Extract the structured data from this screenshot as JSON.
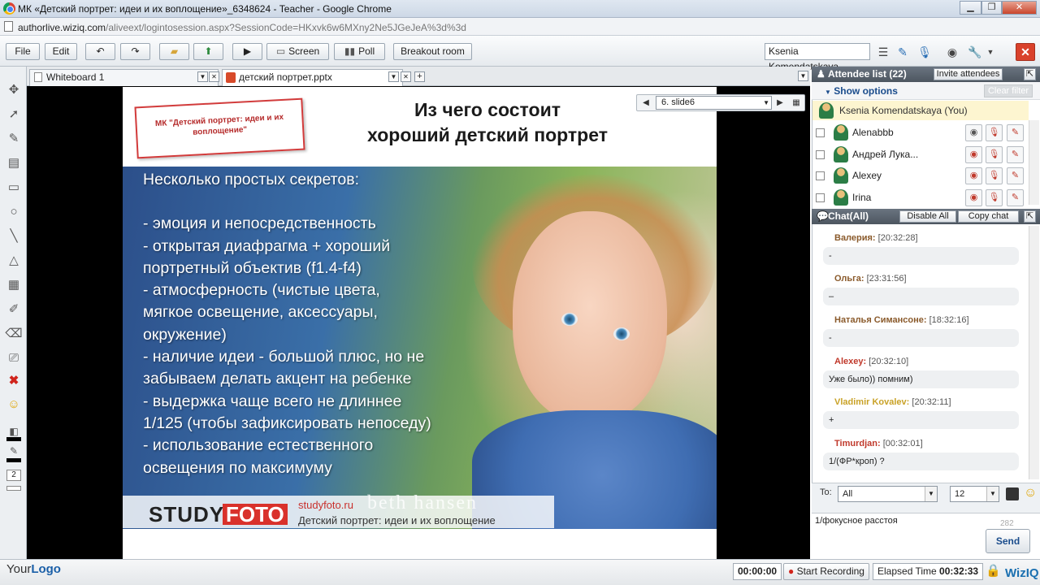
{
  "browser": {
    "title": "МК «Детский портрет: идеи и их воплощение»_6348624 - Teacher - Google Chrome",
    "url_host": "authorlive.wiziq.com",
    "url_path": "/aliveext/logintosession.aspx?SessionCode=HKxvk6w6MXny2Ne5JGeJeA%3d%3d"
  },
  "toolbar": {
    "file": "File",
    "edit": "Edit",
    "screen": "Screen",
    "poll": "Poll",
    "breakout": "Breakout room",
    "user": "Ksenia  Komendatskaya"
  },
  "tabs": [
    {
      "label": "Whiteboard 1"
    },
    {
      "label": "детский портрет.pptx"
    }
  ],
  "slide_nav": {
    "current": "6. slide6"
  },
  "slide": {
    "stamp": "МК \"Детский портрет: идеи и их воплощение\"",
    "title_line1": "Из чего состоит",
    "title_line2": "хороший детский портрет",
    "lines": [
      "Несколько простых секретов:",
      "",
      "- эмоция и непосредственность",
      "- открытая диафрагма + хороший",
      "портретный объектив (f1.4-f4)",
      "- атмосферность (чистые цвета,",
      "мягкое освещение, аксессуары,",
      "окружение)",
      "- наличие идеи - большой плюс, но не",
      "забываем делать акцент на ребенке",
      "- выдержка чаще всего не длиннее",
      "1/125 (чтобы зафиксировать непоседу)",
      "- использование естественного",
      "освещения по максимуму"
    ],
    "brand_study": "STUDY",
    "brand_foto": "FOTO",
    "brand_site": "studyfoto.ru",
    "brand_sub": "Детский портрет: идеи и их воплощение",
    "watermark": "beth hansen"
  },
  "attendees": {
    "header": "Attendee list (22)",
    "invite": "Invite attendees",
    "show_options": "Show options",
    "clear_filter": "Clear filter",
    "you": "Ksenia  Komendatskaya (You)",
    "list": [
      {
        "name": "Alenabbb"
      },
      {
        "name": "Андрей Лука..."
      },
      {
        "name": "Alexey"
      },
      {
        "name": "Irina"
      }
    ]
  },
  "chat": {
    "header": "Chat(All)",
    "disable_all": "Disable All",
    "copy_chat": "Copy chat",
    "messages": [
      {
        "who": "Валерия:",
        "time": "[20:32:28]",
        "text": "-",
        "color": "#8a5a2b"
      },
      {
        "who": "Ольга:",
        "time": "[23:31:56]",
        "text": "–",
        "color": "#8a5a2b"
      },
      {
        "who": "Наталья Симансоне:",
        "time": "[18:32:16]",
        "text": "-",
        "color": "#8a5a2b"
      },
      {
        "who": "Alexey:",
        "time": "[20:32:10]",
        "text": "Уже было)) помним)",
        "color": "#c0392b"
      },
      {
        "who": "Vladimir Kovalev:",
        "time": "[20:32:11]",
        "text": "+",
        "color": "#c9a227"
      },
      {
        "who": "Timurdjan:",
        "time": "[00:32:01]",
        "text": "1/(ФР*кроп) ?",
        "color": "#c0392b"
      }
    ],
    "to_label": "To:",
    "to_value": "All",
    "font_size": "12",
    "input_text": "1/фокусное расстоя",
    "char_count": "282",
    "send": "Send"
  },
  "status": {
    "logo_your": "Your",
    "logo_logo": "Logo",
    "timer": "00:00:00",
    "start_recording": "Start Recording",
    "elapsed_label": "Elapsed Time",
    "elapsed_value": "00:32:33",
    "brand": "WizIQ"
  }
}
